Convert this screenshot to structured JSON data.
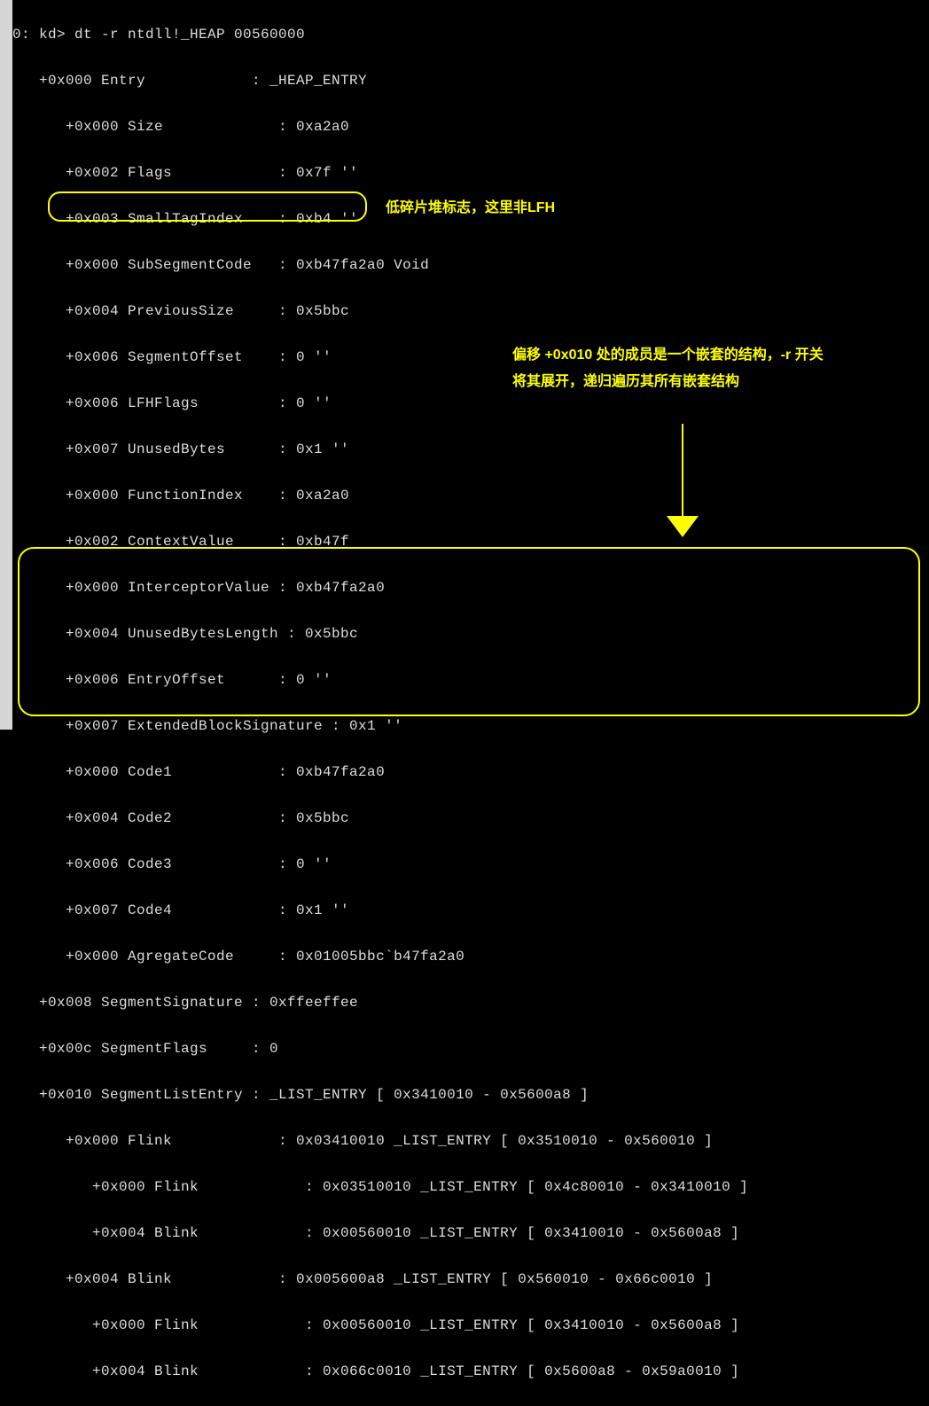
{
  "prompt": "0: kd> dt -r ntdll!_HEAP 00560000",
  "lines": {
    "l0": "   +0x000 Entry            : _HEAP_ENTRY",
    "l1": "      +0x000 Size             : 0xa2a0",
    "l2": "      +0x002 Flags            : 0x7f ''",
    "l3": "      +0x003 SmallTagIndex    : 0xb4 ''",
    "l4": "      +0x000 SubSegmentCode   : 0xb47fa2a0 Void",
    "l5": "      +0x004 PreviousSize     : 0x5bbc",
    "l6": "      +0x006 SegmentOffset    : 0 ''",
    "l7": "      +0x006 LFHFlags         : 0 ''",
    "l8": "      +0x007 UnusedBytes      : 0x1 ''",
    "l9": "      +0x000 FunctionIndex    : 0xa2a0",
    "l10": "      +0x002 ContextValue     : 0xb47f",
    "l11": "      +0x000 InterceptorValue : 0xb47fa2a0",
    "l12": "      +0x004 UnusedBytesLength : 0x5bbc",
    "l13": "      +0x006 EntryOffset      : 0 ''",
    "l14": "      +0x007 ExtendedBlockSignature : 0x1 ''",
    "l15": "      +0x000 Code1            : 0xb47fa2a0",
    "l16": "      +0x004 Code2            : 0x5bbc",
    "l17": "      +0x006 Code3            : 0 ''",
    "l18": "      +0x007 Code4            : 0x1 ''",
    "l19": "      +0x000 AgregateCode     : 0x01005bbc`b47fa2a0",
    "l20": "   +0x008 SegmentSignature : 0xffeeffee",
    "l21": "   +0x00c SegmentFlags     : 0",
    "l22": "   +0x010 SegmentListEntry : _LIST_ENTRY [ 0x3410010 - 0x5600a8 ]",
    "l23": "      +0x000 Flink            : 0x03410010 _LIST_ENTRY [ 0x3510010 - 0x560010 ]",
    "l24": "         +0x000 Flink            : 0x03510010 _LIST_ENTRY [ 0x4c80010 - 0x3410010 ]",
    "l25": "         +0x004 Blink            : 0x00560010 _LIST_ENTRY [ 0x3410010 - 0x5600a8 ]",
    "l26": "      +0x004 Blink            : 0x005600a8 _LIST_ENTRY [ 0x560010 - 0x66c0010 ]",
    "l27": "         +0x000 Flink            : 0x00560010 _LIST_ENTRY [ 0x3410010 - 0x5600a8 ]",
    "l28": "         +0x004 Blink            : 0x066c0010 _LIST_ENTRY [ 0x5600a8 - 0x59a0010 ]"
  },
  "annotations": {
    "lfh": "低碎片堆标志，这里非LFH",
    "nested": "偏移 +0x010 处的成员是一个嵌套的结构，-r 开关将其展开，递归遍历其所有嵌套结构"
  }
}
